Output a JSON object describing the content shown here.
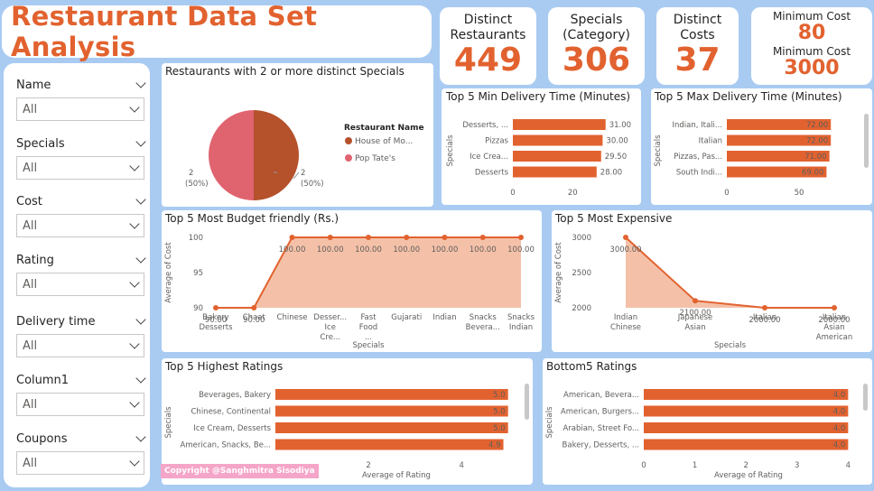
{
  "header": {
    "title": "Restaurant Data Set Analysis"
  },
  "kpis": [
    {
      "label": "Distinct Restaurants",
      "value": "449"
    },
    {
      "label": "Specials (Category)",
      "value": "306"
    },
    {
      "label": "Distinct Costs",
      "value": "37"
    }
  ],
  "kpi_cost": {
    "min_label": "Minimum Cost",
    "min_value": "80",
    "max_label": "Minimum Cost",
    "max_value": "3000"
  },
  "slicers": [
    {
      "label": "Name",
      "value": "All"
    },
    {
      "label": "Specials",
      "value": "All"
    },
    {
      "label": "Cost",
      "value": "All"
    },
    {
      "label": "Rating",
      "value": "All"
    },
    {
      "label": "Delivery time",
      "value": "All"
    },
    {
      "label": "Column1",
      "value": "All"
    },
    {
      "label": "Coupons",
      "value": "All"
    }
  ],
  "copyright": "Copyright @Sanghmitra Sisodiya",
  "colors": {
    "accent": "#e2622f",
    "pie_a": "#b5512b",
    "pie_b": "#e0646f",
    "area": "#f4c1a8"
  },
  "chart_data": [
    {
      "type": "pie",
      "title": "Restaurants with 2 or more distinct Specials",
      "legend_title": "Restaurant Name",
      "categories": [
        "House of Mo...",
        "Pop Tate's"
      ],
      "values": [
        2,
        2
      ],
      "labels": [
        "2\n(50%)",
        "2\n(50%)"
      ]
    },
    {
      "type": "bar",
      "title": "Top 5 Min Delivery Time (Minutes)",
      "ylabel": "Specials",
      "categories": [
        "Desserts, ...",
        "Pizzas",
        "Ice Crea...",
        "Desserts"
      ],
      "values": [
        31.0,
        30.0,
        29.5,
        28.0
      ],
      "xticks": [
        "0",
        "20"
      ],
      "xlim": [
        0,
        35
      ]
    },
    {
      "type": "bar",
      "title": "Top 5 Max Delivery Time (Minutes)",
      "ylabel": "Specials",
      "categories": [
        "Indian, Itali...",
        "Italian",
        "Pizzas, Pas...",
        "South Indi..."
      ],
      "values": [
        72,
        72,
        71,
        69
      ],
      "xticks": [
        "0",
        "50"
      ],
      "xlim": [
        0,
        80
      ]
    },
    {
      "type": "area",
      "title": "Top 5 Most Budget friendly (Rs.)",
      "xlabel": "Specials",
      "ylabel": "Average of Cost",
      "categories": [
        "Bakery, Desserts",
        "Chaat",
        "Chinese",
        "Desser... Ice Cre...",
        "Fast Food, ...",
        "Gujarati",
        "Indian",
        "Snacks, Bevera...",
        "Snacks, Indian"
      ],
      "values": [
        90,
        90,
        100,
        100,
        100,
        100,
        100,
        100,
        100
      ],
      "data_labels": [
        "90.00",
        "90.00",
        "100.00",
        "100.00",
        "100.00",
        "100.00",
        "100.00",
        "100.00",
        "100.00"
      ],
      "yticks": [
        "100",
        "95",
        "90"
      ],
      "ylim": [
        90,
        100
      ]
    },
    {
      "type": "area",
      "title": "Top 5 Most Expensive",
      "xlabel": "Specials",
      "ylabel": "Average of Cost",
      "categories": [
        "Indian, Chinese",
        "Japanese, Asian",
        "Italian",
        "Italian, Asian, American"
      ],
      "values": [
        3000,
        2100,
        2000,
        2000
      ],
      "data_labels": [
        "3000.00",
        "2100.00",
        "2000.00",
        "2000.00"
      ],
      "yticks": [
        "3000",
        "2500",
        "2000"
      ],
      "ylim": [
        2000,
        3000
      ]
    },
    {
      "type": "bar",
      "title": "Top 5 Highest Ratings",
      "xlabel": "Average of Rating",
      "ylabel": "Specials",
      "categories": [
        "Beverages, Bakery",
        "Chinese, Continental",
        "Ice Cream, Desserts",
        "American, Snacks, Be..."
      ],
      "values": [
        5.0,
        5.0,
        5.0,
        4.9
      ],
      "data_labels": [
        "5.0",
        "5.0",
        "5.0",
        "4.9"
      ],
      "xticks": [
        "2",
        "4"
      ],
      "xlim": [
        0,
        5.2
      ]
    },
    {
      "type": "bar",
      "title": "Bottom5 Ratings",
      "xlabel": "Average of Rating",
      "ylabel": "Specials",
      "categories": [
        "American, Bevera...",
        "American, Burgers...",
        "Arabian, Street Fo...",
        "Bakery, Desserts, ..."
      ],
      "values": [
        4.0,
        4.0,
        4.0,
        4.0
      ],
      "data_labels": [
        "4.0",
        "4.0",
        "4.0",
        "4.0"
      ],
      "xticks": [
        "0",
        "1",
        "2",
        "3",
        "4"
      ],
      "xlim": [
        0,
        4.1
      ]
    }
  ]
}
